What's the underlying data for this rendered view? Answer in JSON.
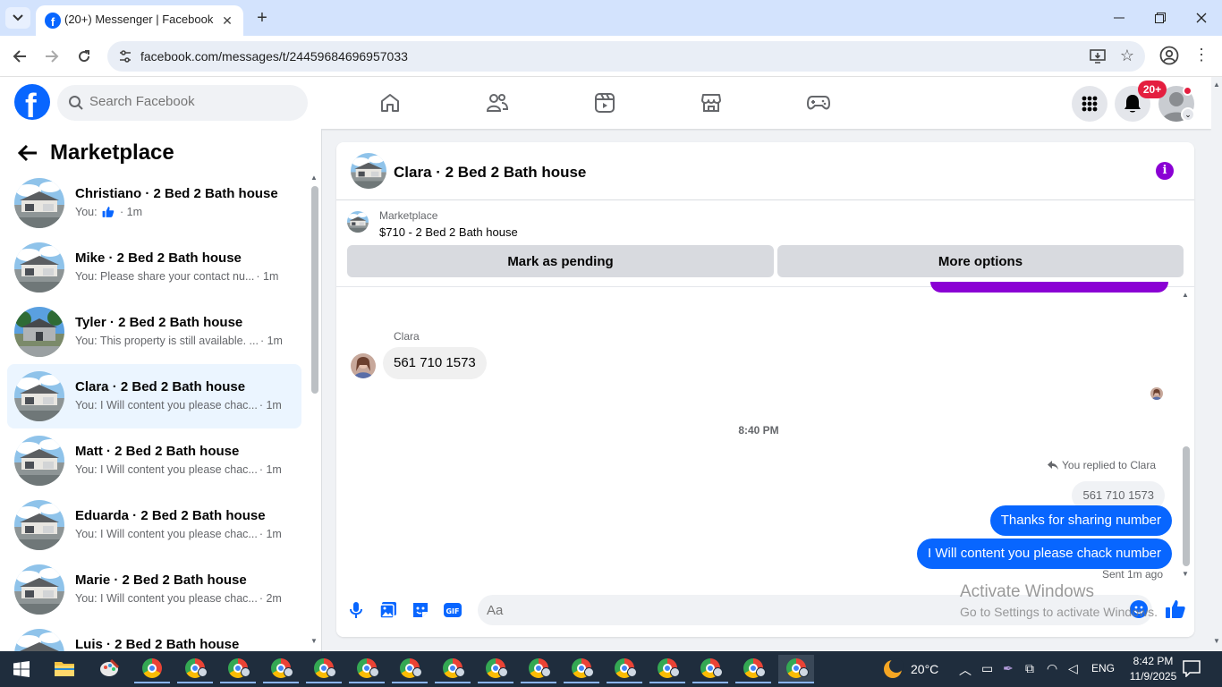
{
  "browser": {
    "tab_title": "(20+) Messenger | Facebook",
    "url": "facebook.com/messages/t/24459684696957033"
  },
  "facebook": {
    "search_placeholder": "Search Facebook",
    "notification_count": "20+"
  },
  "sidebar": {
    "title": "Marketplace",
    "conversations": [
      {
        "name": "Christiano · 2 Bed 2 Bath house",
        "preview_prefix": "You: ",
        "preview_icon": "thumbs-up-icon",
        "time": "· 1m",
        "active": false
      },
      {
        "name": "Mike · 2 Bed 2 Bath house",
        "preview": "You: Please share your contact nu...",
        "time": "· 1m",
        "active": false
      },
      {
        "name": "Tyler · 2 Bed 2 Bath house",
        "preview": "You: This property is still available. ...",
        "time": "· 1m",
        "active": false
      },
      {
        "name": "Clara · 2 Bed 2 Bath house",
        "preview": "You: I Will content you please chac...",
        "time": "· 1m",
        "active": true
      },
      {
        "name": "Matt · 2 Bed 2 Bath house",
        "preview": "You: I Will content you please chac...",
        "time": "· 1m",
        "active": false
      },
      {
        "name": "Eduarda · 2 Bed 2 Bath house",
        "preview": "You: I Will content you please chac...",
        "time": "· 1m",
        "active": false
      },
      {
        "name": "Marie · 2 Bed 2 Bath house",
        "preview": "You: I Will content you please chac...",
        "time": "· 2m",
        "active": false
      },
      {
        "name": "Luis · 2 Bed 2 Bath house",
        "preview": "",
        "time": "",
        "active": false
      }
    ]
  },
  "chat": {
    "title": "Clara · 2 Bed 2 Bath house",
    "marketplace_label": "Marketplace",
    "listing": "$710 - 2 Bed 2 Bath house",
    "mark_pending_label": "Mark as pending",
    "more_options_label": "More options",
    "incoming_sender": "Clara",
    "incoming_message": "561 710 1573",
    "time_separator": "8:40 PM",
    "reply_note": "You replied to Clara",
    "quoted_message": "561 710 1573",
    "outgoing_messages": [
      "Thanks for sharing number",
      "I Will content you please chack number"
    ],
    "sent_status": "Sent 1m ago",
    "input_placeholder": "Aa"
  },
  "watermark": {
    "title": "Activate Windows",
    "subtitle": "Go to Settings to activate Windows."
  },
  "taskbar": {
    "weather": "20°C",
    "language": "ENG",
    "time": "8:42 PM",
    "date": "11/9/2025"
  },
  "colors": {
    "facebook_blue": "#0866ff",
    "messenger_purple": "#8a00d4",
    "notification_red": "#e41e3f",
    "tabbar_blue": "#d3e3fd"
  }
}
